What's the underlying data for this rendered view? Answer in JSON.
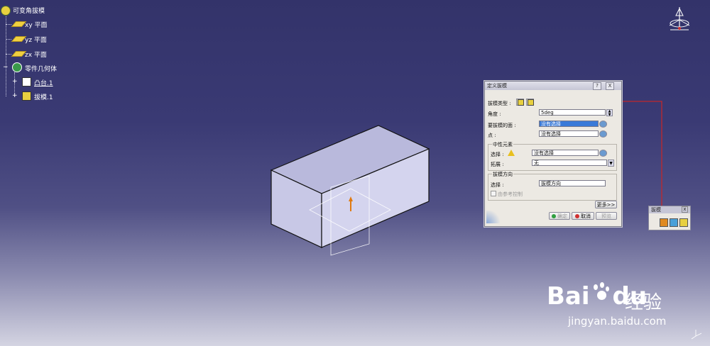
{
  "tree": {
    "root": "可变角拔模",
    "items": [
      "xy 平面",
      "yz 平面",
      "zx 平面",
      "零件几何体",
      "凸台.1",
      "拔模.1"
    ]
  },
  "dialog": {
    "title": "定义拔模",
    "help_btn": "?",
    "close_btn": "X",
    "draft_type_label": "拔模类型 :",
    "angle_label": "角度 :",
    "angle_value": "5deg",
    "faces_label": "要拔模的面 :",
    "faces_value": "没有选择",
    "point_label": "点 :",
    "point_value": "没有选择",
    "neutral_group": "中性元素",
    "select_label": "选择 :",
    "select_value": "没有选择",
    "propagation_label": "拓展 :",
    "propagation_value": "无",
    "direction_group": "拔模方向",
    "direction_select_label": "选择 :",
    "direction_value": "拔模方向",
    "checkbox_label": "由参考控制",
    "more_btn": "更多>>",
    "ok_btn": "确定",
    "cancel_btn": "取消",
    "preview_btn": "预览"
  },
  "mini_toolbar": {
    "title": "拔模",
    "close": "x"
  },
  "watermark": {
    "brand": "Bai",
    "brand2": "du",
    "cn": "经验",
    "url": "jingyan.baidu.com"
  },
  "colors": {
    "annotation": "#c0282c",
    "selection": "#3a7ad8"
  }
}
